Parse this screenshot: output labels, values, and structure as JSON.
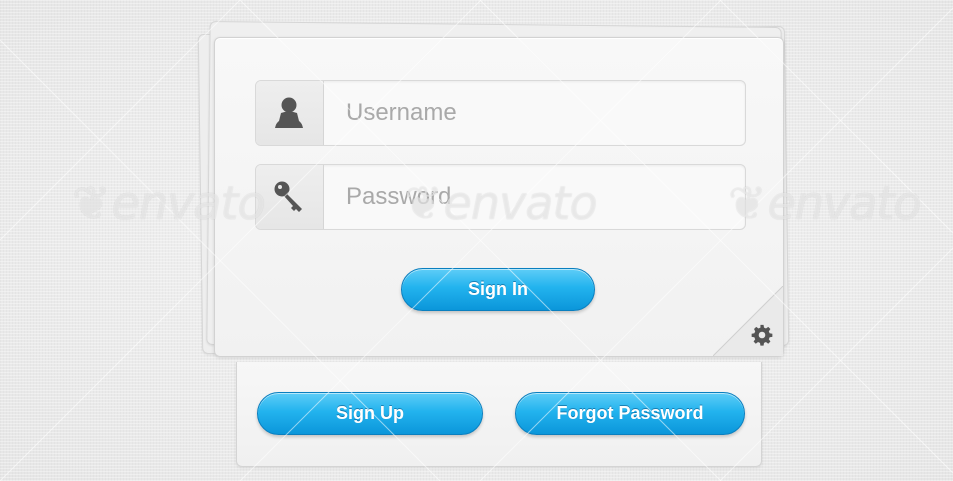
{
  "login_card": {
    "username_placeholder": "Username",
    "password_placeholder": "Password",
    "sign_in_label": "Sign In"
  },
  "lower_panel": {
    "sign_up_label": "Sign Up",
    "forgot_password_label": "Forgot Password"
  },
  "icons": {
    "username": "user-icon",
    "password": "key-icon",
    "settings": "gear-icon"
  },
  "watermark": {
    "text": "envato"
  },
  "colors": {
    "button_top": "#5ecdf7",
    "button_bottom": "#0b96da",
    "icon": "#555555",
    "background": "#ececec"
  }
}
